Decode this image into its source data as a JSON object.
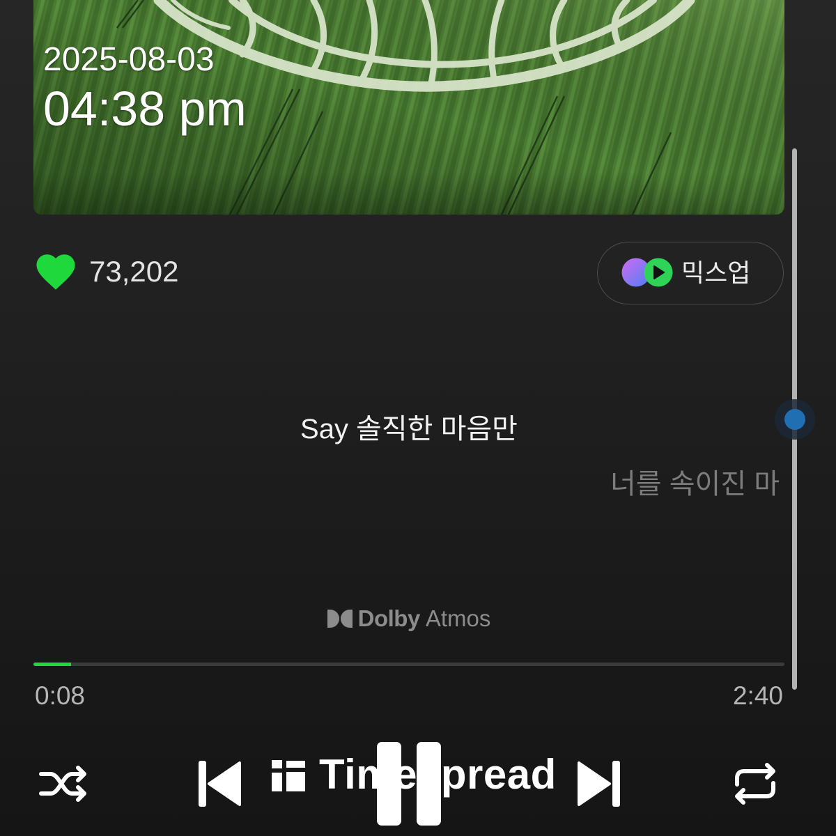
{
  "watermark": {
    "date": "2025-08-03",
    "time": "04:38 pm",
    "brand": "Timespread",
    "brand_icon": "timespread-logo-icon"
  },
  "like": {
    "icon": "heart-icon",
    "liked": true,
    "count": "73,202"
  },
  "mixup": {
    "icon": "mixup-icon",
    "label": "믹스업"
  },
  "lyrics": {
    "current_line": "Say 솔직한 마음만",
    "next_line": "너를 속이진 마"
  },
  "audio_format": {
    "icon": "dolby-logo-icon",
    "brand": "Dolby",
    "format": "Atmos"
  },
  "playback": {
    "elapsed": "0:08",
    "duration": "2:40",
    "progress": 0.05,
    "is_playing": true
  },
  "lyrics_scrollbar": {
    "position": 0.5
  },
  "controls": {
    "shuffle": "shuffle-icon",
    "previous": "skip-previous-icon",
    "play_pause": "pause-icon",
    "next": "skip-next-icon",
    "repeat": "repeat-icon"
  },
  "colors": {
    "accent": "#1ed83c",
    "scroll_thumb": "#1f6fb2",
    "lyric_active": "#f2f2f2",
    "lyric_inactive": "#7c7c7c",
    "secondary_text": "#b6b6b6",
    "background": "#1c1c1c"
  }
}
